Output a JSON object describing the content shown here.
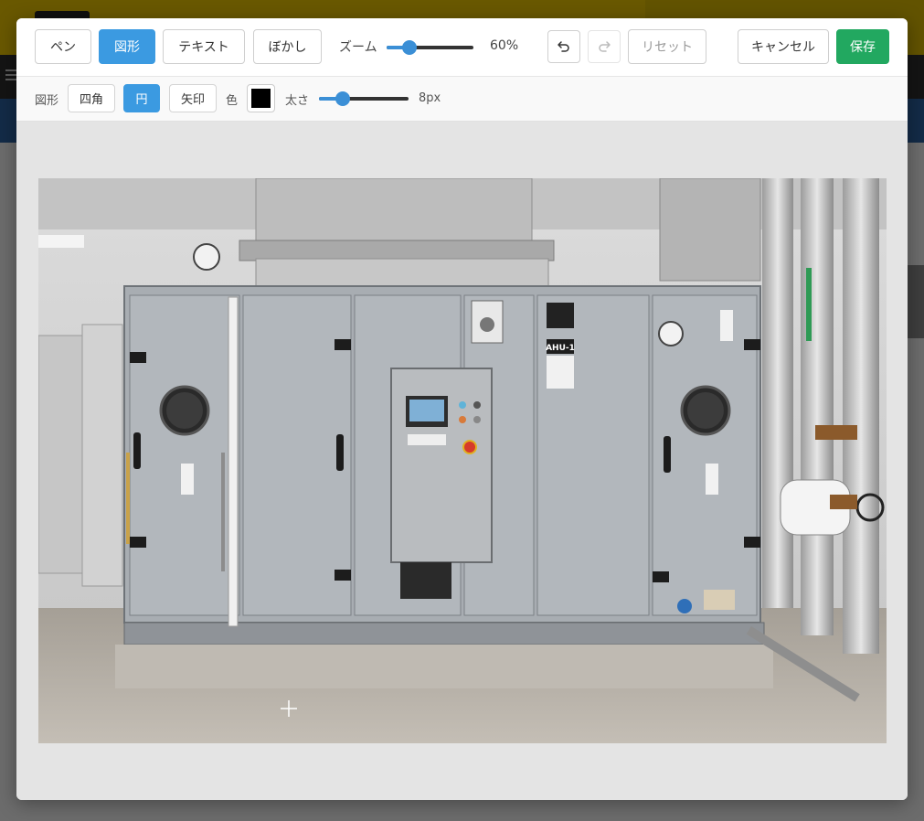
{
  "toolbar": {
    "tools": {
      "pen": "ペン",
      "shape": "図形",
      "text": "テキスト",
      "blur": "ぼかし"
    },
    "active_tool": "shape",
    "zoom": {
      "label": "ズーム",
      "value_text": "60%",
      "value": 60,
      "min": 10,
      "max": 200
    },
    "undo_icon": "undo-icon",
    "redo_icon": "redo-icon",
    "reset": "リセット",
    "cancel": "キャンセル",
    "save": "保存"
  },
  "shape_options": {
    "label": "図形",
    "shapes": {
      "rect": "四角",
      "circle": "円",
      "arrow": "矢印"
    },
    "active_shape": "circle",
    "color_label": "色",
    "color": "#000000",
    "thickness_label": "太さ",
    "thickness_text": "8px",
    "thickness": 8,
    "thickness_max": 30
  },
  "photo": {
    "unit_label": "AHU-1"
  },
  "colors": {
    "accent": "#3b9ae1",
    "save": "#22a860"
  }
}
